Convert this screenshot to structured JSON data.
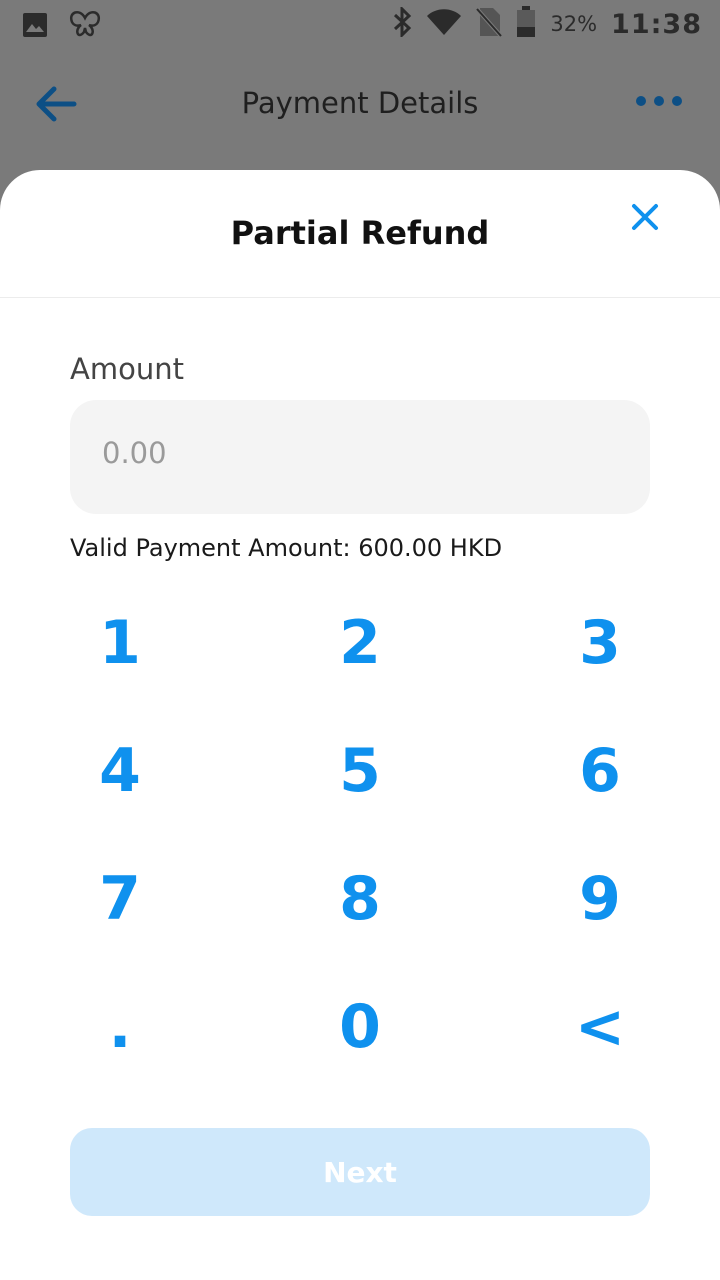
{
  "status_bar": {
    "battery_percent": "32%",
    "time": "11:38",
    "left_icons": [
      "image-icon",
      "butterfly-icon"
    ],
    "right_icons": [
      "bluetooth-icon",
      "wifi-icon",
      "no-sim-icon",
      "battery-icon"
    ]
  },
  "app_bar": {
    "title": "Payment Details",
    "back_icon": "arrow-left-icon",
    "menu_icon": "more-horizontal-icon"
  },
  "sheet": {
    "title": "Partial Refund",
    "close_icon": "close-icon",
    "amount_label": "Amount",
    "amount_placeholder": "0.00",
    "amount_value": "",
    "valid_text": "Valid Payment Amount: 600.00 HKD"
  },
  "keypad": {
    "keys": [
      "1",
      "2",
      "3",
      "4",
      "5",
      "6",
      "7",
      "8",
      "9",
      ".",
      "0",
      "<"
    ]
  },
  "next_label": "Next",
  "colors": {
    "accent": "#0f91ee",
    "next_disabled_bg": "#cfe8fb",
    "field_bg": "#f4f4f4",
    "scrim": "#7a7a7a"
  }
}
